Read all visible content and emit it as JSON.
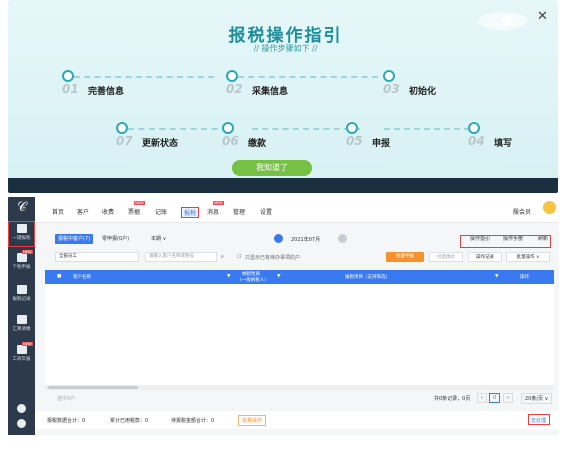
{
  "guide": {
    "title": "报税操作指引",
    "subtitle": "// 操作步骤如下 //",
    "close_icon": "close-icon",
    "steps": [
      {
        "num": "01",
        "label": "完善信息"
      },
      {
        "num": "02",
        "label": "采集信息"
      },
      {
        "num": "03",
        "label": "初始化"
      },
      {
        "num": "07",
        "label": "更新状态"
      },
      {
        "num": "06",
        "label": "缴款"
      },
      {
        "num": "05",
        "label": "申报"
      },
      {
        "num": "04",
        "label": "填写"
      }
    ],
    "confirm_button": "我知道了"
  },
  "sidebar": {
    "items": [
      {
        "label": "一键报税",
        "icon": "declare-icon",
        "new": ""
      },
      {
        "label": "个税申报",
        "icon": "person-tax-icon",
        "new": "NEW"
      },
      {
        "label": "报税记录",
        "icon": "record-icon",
        "new": ""
      },
      {
        "label": "汇算清缴",
        "icon": "settle-icon",
        "new": ""
      },
      {
        "label": "工商年报",
        "icon": "annual-report-icon",
        "new": "NEW"
      }
    ]
  },
  "topnav": {
    "items": [
      "首页",
      "客户",
      "收费",
      "票据",
      "记账",
      "报税",
      "消息",
      "管理",
      "设置"
    ],
    "active": "报税",
    "new_badge": "NEW",
    "user": "殷会员"
  },
  "toolbar": {
    "tabs": [
      "报税中客户(7)",
      "零申报(0户)"
    ],
    "scope": "本期 ∨",
    "period": "2021年07月",
    "guide_link": "操作指引",
    "manual_link": "操作手册",
    "refresh_link": "刷新"
  },
  "filters": {
    "staff": "全部员工",
    "search_placeholder": "请输入客户名称或税号",
    "checkbox_label": "只显示已有待办事项的户",
    "btn_batch_declare": "批量申报",
    "btn_batch_pay": "批量缴款",
    "btn_op_record": "操作记录",
    "btn_batch_op": "批量操作 ∨"
  },
  "table": {
    "headers": [
      "客户名称",
      "纳税性质",
      "报税项目（支持筛选）",
      "操作"
    ],
    "type_sub": "(一般纳税人)",
    "empty": ""
  },
  "pager": {
    "summary": "共0条记录，0页",
    "page": "0",
    "size": "20条/页 ∨",
    "left": "选中0户"
  },
  "footer": {
    "f1": "报税数据合计：0",
    "f2": "累计已用税款：0",
    "f3": "待报税金额合计：0",
    "link": "批量操作",
    "right": "去处理"
  }
}
